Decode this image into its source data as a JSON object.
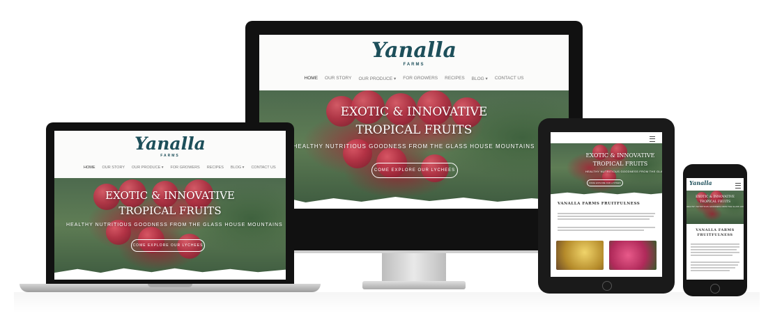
{
  "site": {
    "logo_word": "Yanalla",
    "logo_sub": "FARMS",
    "nav": [
      "HOME",
      "OUR STORY",
      "OUR PRODUCE ▾",
      "FOR GROWERS",
      "RECIPES",
      "BLOG ▾",
      "CONTACT US"
    ],
    "hero_title_1": "EXOTIC & INNOVATIVE",
    "hero_title_2": "TROPICAL FRUITS",
    "hero_subtitle": "HEALTHY NUTRITIOUS GOODNESS FROM THE GLASS HOUSE MOUNTAINS",
    "hero_button": "COME EXPLORE OUR LYCHEES",
    "section_title_tablet": "VANALLA FARMS FRUITFULNESS",
    "section_title_phone_1": "VANALLA FARMS",
    "section_title_phone_2": "FRUITFULNESS"
  },
  "icons": {
    "menu": "hamburger-menu-icon"
  },
  "colors": {
    "brand": "#1d4f5a",
    "device": "#111111",
    "hero_fruit": "#b83045",
    "foliage": "#4d6a4e"
  }
}
